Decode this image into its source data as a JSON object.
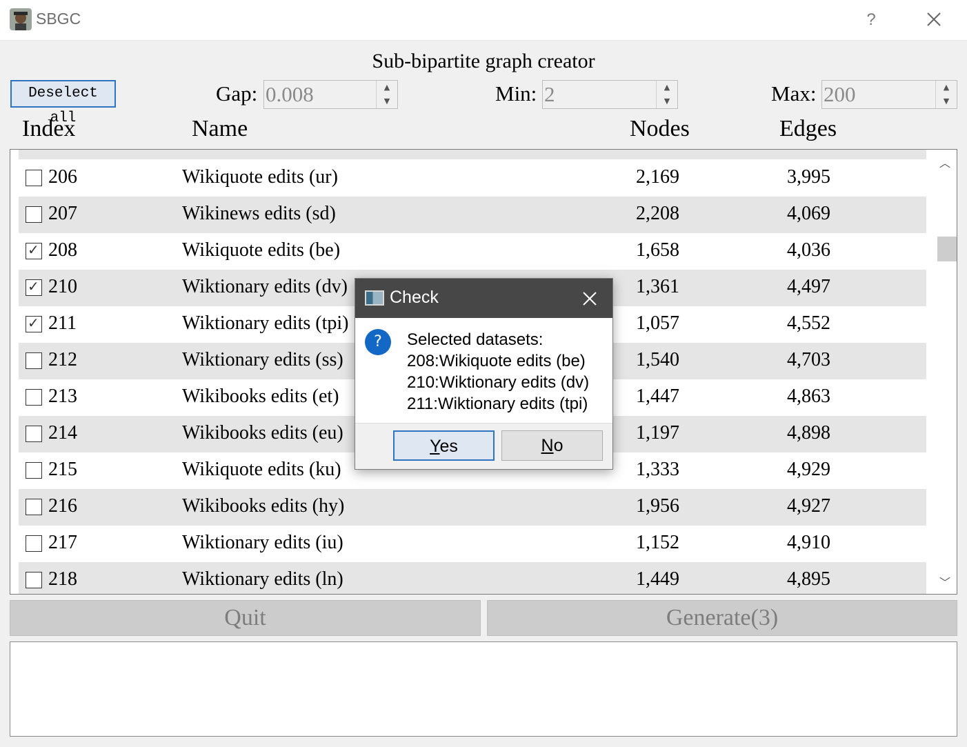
{
  "window": {
    "title": "SBGC",
    "help_label": "?"
  },
  "heading": "Sub-bipartite graph creator",
  "controls": {
    "deselect_label": "Deselect all",
    "gap": {
      "label": "Gap:",
      "value": "0.008"
    },
    "min": {
      "label": "Min:",
      "value": "2"
    },
    "max": {
      "label": "Max:",
      "value": "200"
    }
  },
  "table": {
    "columns": [
      "Index",
      "Name",
      "Nodes",
      "Edges"
    ],
    "rows": [
      {
        "checked": false,
        "index": "206",
        "name": "Wikiquote edits (ur)",
        "nodes": "2,169",
        "edges": "3,995"
      },
      {
        "checked": false,
        "index": "207",
        "name": "Wikinews edits (sd)",
        "nodes": "2,208",
        "edges": "4,069"
      },
      {
        "checked": true,
        "index": "208",
        "name": "Wikiquote edits (be)",
        "nodes": "1,658",
        "edges": "4,036"
      },
      {
        "checked": true,
        "index": "210",
        "name": "Wiktionary edits (dv)",
        "nodes": "1,361",
        "edges": "4,497"
      },
      {
        "checked": true,
        "index": "211",
        "name": "Wiktionary edits (tpi)",
        "nodes": "1,057",
        "edges": "4,552"
      },
      {
        "checked": false,
        "index": "212",
        "name": "Wiktionary edits (ss)",
        "nodes": "1,540",
        "edges": "4,703"
      },
      {
        "checked": false,
        "index": "213",
        "name": "Wikibooks edits (et)",
        "nodes": "1,447",
        "edges": "4,863"
      },
      {
        "checked": false,
        "index": "214",
        "name": "Wikibooks edits (eu)",
        "nodes": "1,197",
        "edges": "4,898"
      },
      {
        "checked": false,
        "index": "215",
        "name": "Wikiquote edits (ku)",
        "nodes": "1,333",
        "edges": "4,929"
      },
      {
        "checked": false,
        "index": "216",
        "name": "Wikibooks edits (hy)",
        "nodes": "1,956",
        "edges": "4,927"
      },
      {
        "checked": false,
        "index": "217",
        "name": "Wiktionary edits (iu)",
        "nodes": "1,152",
        "edges": "4,910"
      },
      {
        "checked": false,
        "index": "218",
        "name": "Wiktionary edits (ln)",
        "nodes": "1,449",
        "edges": "4,895"
      }
    ]
  },
  "buttons": {
    "quit": "Quit",
    "generate": "Generate(3)"
  },
  "log_text": "",
  "dialog": {
    "title": "Check",
    "lines": [
      "Selected datasets:",
      "208:Wikiquote edits (be)",
      "210:Wiktionary edits (dv)",
      "211:Wiktionary edits (tpi)"
    ],
    "yes": {
      "mnemonic": "Y",
      "rest": "es"
    },
    "no": {
      "mnemonic": "N",
      "rest": "o"
    }
  }
}
